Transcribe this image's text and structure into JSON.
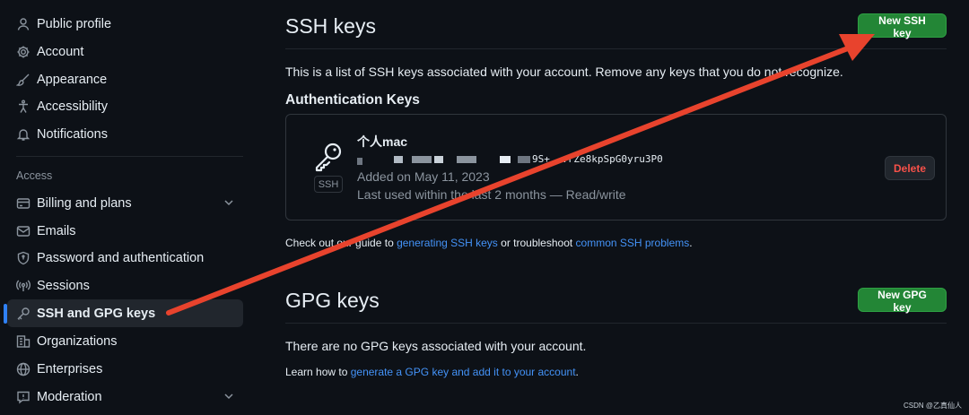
{
  "sidebar": {
    "items_top": [
      {
        "label": "Public profile",
        "icon": "person-icon"
      },
      {
        "label": "Account",
        "icon": "gear-icon"
      },
      {
        "label": "Appearance",
        "icon": "paintbrush-icon"
      },
      {
        "label": "Accessibility",
        "icon": "accessibility-icon"
      },
      {
        "label": "Notifications",
        "icon": "bell-icon"
      }
    ],
    "group_title": "Access",
    "items_access": [
      {
        "label": "Billing and plans",
        "icon": "credit-card-icon",
        "expandable": true
      },
      {
        "label": "Emails",
        "icon": "mail-icon"
      },
      {
        "label": "Password and authentication",
        "icon": "shield-lock-icon"
      },
      {
        "label": "Sessions",
        "icon": "broadcast-icon"
      },
      {
        "label": "SSH and GPG keys",
        "icon": "key-icon",
        "active": true
      },
      {
        "label": "Organizations",
        "icon": "organization-icon"
      },
      {
        "label": "Enterprises",
        "icon": "globe-icon"
      },
      {
        "label": "Moderation",
        "icon": "report-icon",
        "expandable": true
      }
    ]
  },
  "ssh": {
    "title": "SSH keys",
    "new_button": "New SSH key",
    "description": "This is a list of SSH keys associated with your account. Remove any keys that you do not recognize.",
    "auth_heading": "Authentication Keys",
    "key": {
      "name": "个人mac",
      "badge": "SSH",
      "fingerprint_visible": "9S+...rZe8kpSpG0yru3P0",
      "added": "Added on May 11, 2023",
      "last_used": "Last used within the last 2 months — Read/write",
      "delete_label": "Delete"
    },
    "guide_prefix": "Check out our guide to ",
    "guide_link1": "generating SSH keys",
    "guide_middle": " or troubleshoot ",
    "guide_link2": "common SSH problems",
    "guide_suffix": "."
  },
  "gpg": {
    "title": "GPG keys",
    "new_button": "New GPG key",
    "empty": "There are no GPG keys associated with your account.",
    "learn_prefix": "Learn how to ",
    "learn_link": "generate a GPG key and add it to your account",
    "learn_suffix": "."
  },
  "watermark": "CSDN @乙真仙人",
  "colors": {
    "background": "#0d1117",
    "accent_green": "#238636",
    "link": "#4493f8",
    "annotation_arrow": "#e8432d",
    "danger": "#f85149"
  }
}
